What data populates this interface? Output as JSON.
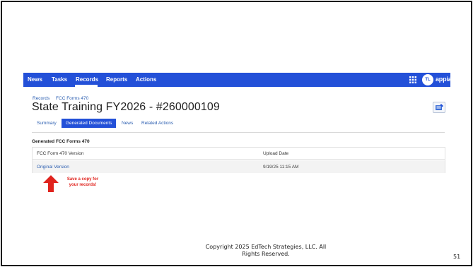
{
  "nav": {
    "items": [
      "News",
      "Tasks",
      "Records",
      "Reports",
      "Actions"
    ],
    "active": "Records",
    "avatar_initials": "TL",
    "brand": "appian"
  },
  "breadcrumb": [
    "Records",
    "FCC Forms 470"
  ],
  "record": {
    "title": "State Training FY2026 - #260000109"
  },
  "tabs": [
    {
      "label": "Summary",
      "selected": false
    },
    {
      "label": "Generated Documents",
      "selected": true
    },
    {
      "label": "News",
      "selected": false
    },
    {
      "label": "Related Actions",
      "selected": false
    }
  ],
  "section": {
    "title": "Generated FCC Forms 470",
    "columns": [
      "FCC Form 470 Version",
      "Upload Date"
    ],
    "rows": [
      {
        "version": "Original Version",
        "upload_date": "9/19/25 11:15 AM"
      }
    ]
  },
  "annotation": {
    "callout_line1": "Save a copy for",
    "callout_line2": "your records!",
    "arrow_color": "#e0231d"
  },
  "footer": {
    "copyright_line1": "Copyright 2025 EdTech Strategies, LLC.  All",
    "copyright_line2": "Rights Reserved.",
    "slide_number": "51"
  },
  "colors": {
    "nav_bar": "#2350d8",
    "link": "#2a5db0",
    "callout": "#e0231d"
  }
}
